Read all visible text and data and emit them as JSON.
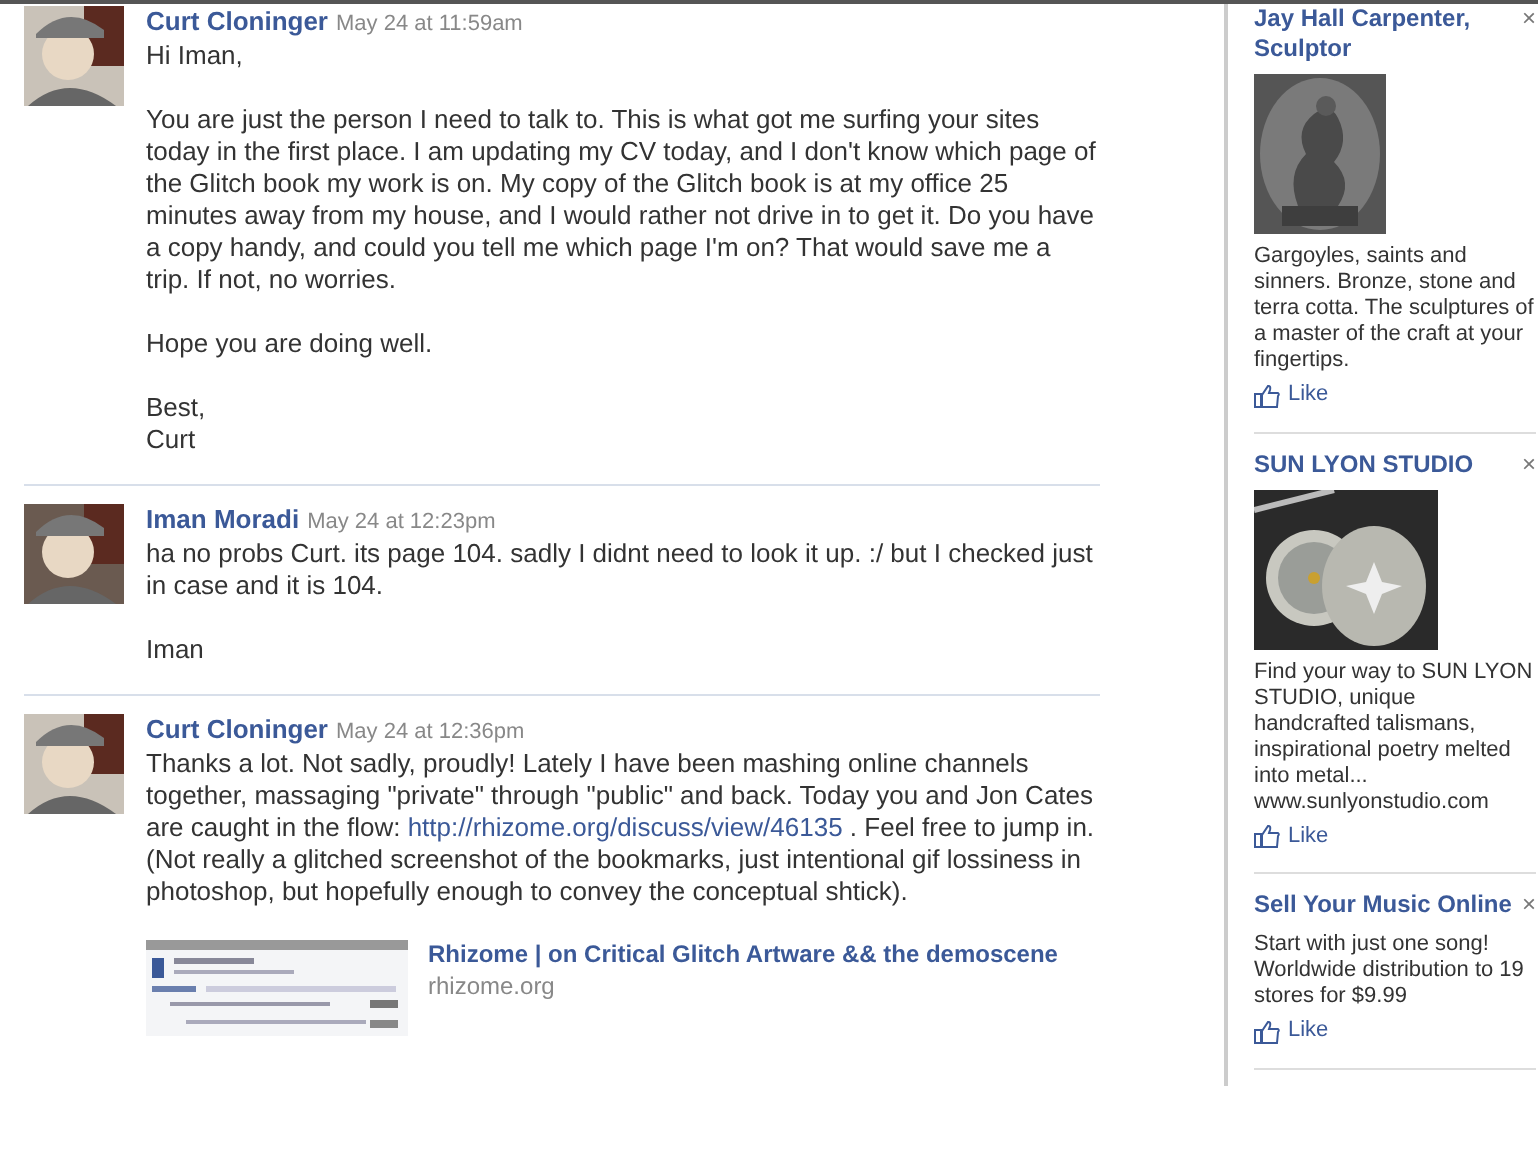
{
  "messages": [
    {
      "author": "Curt Cloninger",
      "time": "May 24 at 11:59am",
      "paragraphs": [
        [
          {
            "kind": "text",
            "text": "Hi Iman,"
          }
        ],
        [
          {
            "kind": "text",
            "text": "You are just the person I need to talk to. This is what got me surfing your sites today in the first place. I am updating my CV today, and I don't know which page of the Glitch book my work is on. My copy of the Glitch book is at my office 25 minutes away from my house, and I would rather not drive in to get it. Do you have a copy handy, and could you tell me which page I'm on? That would save me a trip. If not, no worries."
          }
        ],
        [
          {
            "kind": "text",
            "text": "Hope you are doing well."
          }
        ],
        [
          {
            "kind": "text",
            "text": "Best,"
          },
          {
            "kind": "break"
          },
          {
            "kind": "text",
            "text": "Curt"
          }
        ]
      ]
    },
    {
      "author": "Iman Moradi",
      "time": "May 24 at 12:23pm",
      "paragraphs": [
        [
          {
            "kind": "text",
            "text": "ha no probs Curt. its page 104. sadly I didnt need to look it up. :/ but I checked just in case and it is 104."
          }
        ],
        [
          {
            "kind": "text",
            "text": "Iman"
          }
        ]
      ]
    },
    {
      "author": "Curt Cloninger",
      "time": "May 24 at 12:36pm",
      "paragraphs": [
        [
          {
            "kind": "text",
            "text": "Thanks a lot. Not sadly, proudly! Lately I have been mashing online channels together, massaging \"private\" through \"public\" and back. Today you and Jon Cates are caught in the flow: "
          },
          {
            "kind": "link",
            "text": "http://rhizome.org/discuss/view/46135"
          },
          {
            "kind": "text",
            "text": " . Feel free to jump in. (Not really a glitched screenshot of the bookmarks, just intentional gif lossiness in photoshop, but hopefully enough to convey the conceptual shtick)."
          }
        ]
      ],
      "attachment": {
        "title": "Rhizome | on Critical Glitch Artware && the demoscene",
        "domain": "rhizome.org"
      }
    }
  ],
  "ads": [
    {
      "kind": "image_ad",
      "title": "Jay Hall Carpenter, Sculptor",
      "close": "×",
      "description": "Gargoyles, saints and sinners. Bronze, stone and terra cotta. The sculptures of a master of the craft at your fingertips.",
      "like": "Like"
    },
    {
      "kind": "image_ad",
      "title": "SUN LYON STUDIO",
      "close": "×",
      "description": "Find your way to SUN LYON STUDIO, unique handcrafted talismans, inspirational poetry melted into metal... www.sunlyonstudio.com",
      "like": "Like"
    },
    {
      "kind": "text_ad",
      "title": "Sell Your Music Online",
      "close": "×",
      "description": "Start with just one song! Worldwide distribution to 19 stores for $9.99",
      "like": "Like"
    }
  ]
}
